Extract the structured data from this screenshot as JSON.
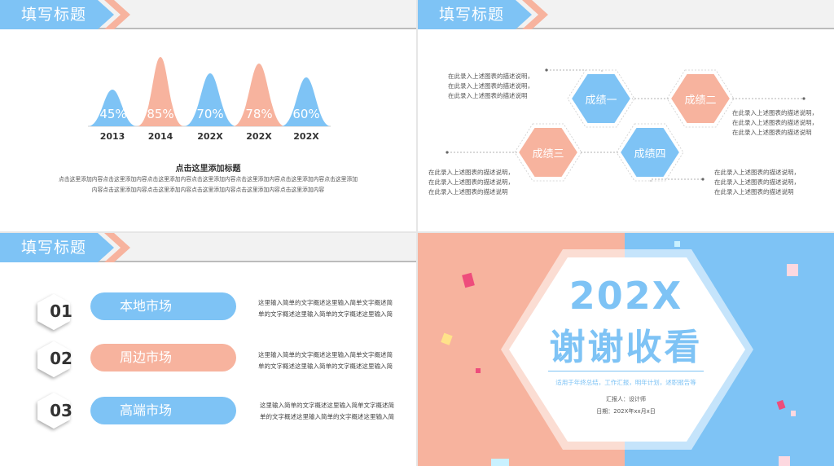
{
  "colors": {
    "blue": "#7ec3f5",
    "pink": "#f7b39e",
    "gray": "#9a9a9a"
  },
  "slide1": {
    "header": "填写标题",
    "peaks": [
      {
        "value": "45%",
        "label": "2013"
      },
      {
        "value": "85%",
        "label": "2014"
      },
      {
        "value": "70%",
        "label": "202X"
      },
      {
        "value": "78%",
        "label": "202X"
      },
      {
        "value": "60%",
        "label": "202X"
      }
    ],
    "caption_title": "点击这里添加标题",
    "caption_line1": "点击这里添加内容点击这里添加内容点击这里添加内容点击这里添加内容点击这里添加内容点击这里添加内容点击这里添加",
    "caption_line2": "内容点击这里添加内容点击这里添加内容点击这里添加内容点击这里添加内容点击这里添加内容"
  },
  "slide2": {
    "header": "填写标题",
    "hex1": "成绩一",
    "hex2": "成绩二",
    "hex3": "成绩三",
    "hex4": "成绩四",
    "desc_line": "在此录入上述图表的描述说明，",
    "desc_last": "在此录入上述图表的描述说明"
  },
  "slide3": {
    "header": "填写标题",
    "items": [
      {
        "num": "01",
        "label": "本地市场",
        "desc1": "这里输入简单的文字概述这里输入简单文字概述简",
        "desc2": "单的文字概述这里输入简单的文字概述这里输入简"
      },
      {
        "num": "02",
        "label": "周边市场",
        "desc1": "这里输入简单的文字概述这里输入简单文字概述简",
        "desc2": "单的文字概述这里输入简单的文字概述这里输入简"
      },
      {
        "num": "03",
        "label": "高端市场",
        "desc1": "这里输入简单的文字概述这里输入简单文字概述简",
        "desc2": "单的文字概述这里输入简单的文字概述这里输入简"
      }
    ]
  },
  "slide4": {
    "year": "202X",
    "thanks": "谢谢收看",
    "subtitle": "适用于年终总结，工作汇报，明年计划，述职报告等",
    "reporter": "汇报人：设计师",
    "date": "日期：202X年xx月x日"
  }
}
